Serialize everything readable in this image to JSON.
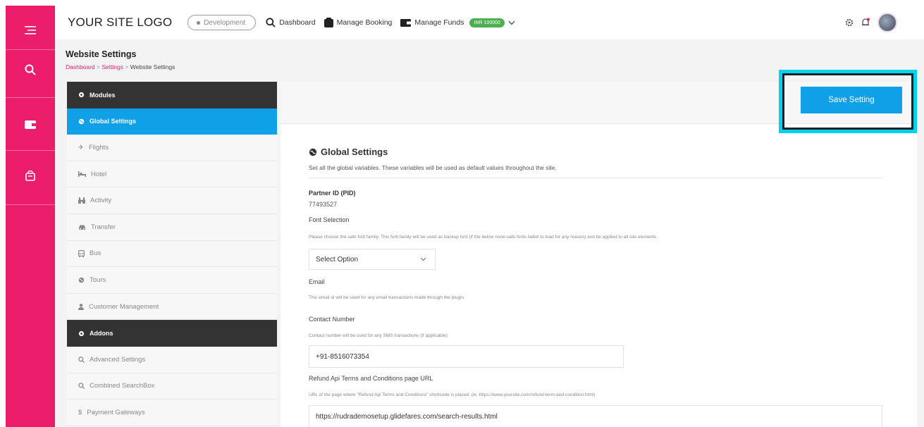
{
  "header": {
    "logo": "YOUR SITE LOGO",
    "environment": "Development",
    "nav": [
      {
        "label": "Dashboard",
        "icon": "search-icon"
      },
      {
        "label": "Manage Booking",
        "icon": "booking-icon"
      },
      {
        "label": "Manage Funds",
        "icon": "wallet-icon"
      }
    ],
    "funds_badge": "INR 100000"
  },
  "page": {
    "title": "Website Settings",
    "breadcrumb": {
      "item1": "Dashboard",
      "sep": ">",
      "item2": "Settings",
      "item3": "Website Settings"
    }
  },
  "sidebar": {
    "modules_header": "Modules",
    "active_item": "Global Settings",
    "modules": [
      {
        "label": "Flights",
        "icon": "plane-icon"
      },
      {
        "label": "Hotel",
        "icon": "bed-icon"
      },
      {
        "label": "Activity",
        "icon": "binoculars-icon"
      },
      {
        "label": "Transfer",
        "icon": "car-icon"
      },
      {
        "label": "Bus",
        "icon": "bus-icon"
      },
      {
        "label": "Tours",
        "icon": "globe-icon"
      },
      {
        "label": "Customer Management",
        "icon": "user-icon"
      }
    ],
    "addons_header": "Addons",
    "addons": [
      {
        "label": "Advanced Settings",
        "icon": "search-icon"
      },
      {
        "label": "Combined SearchBox",
        "icon": "search-icon"
      },
      {
        "label": "Payment Gateways",
        "icon": "dollar-icon"
      }
    ]
  },
  "main": {
    "save_label": "Save Setting",
    "section_title": "Global Settings",
    "section_desc": "Set all the global variables. These variables will be used as default values throughout the site.",
    "partner_label": "Partner ID (PID)",
    "partner_value": "77493527",
    "font_label": "Font Selection",
    "font_hint": "Please choose the safe font family. This font family will be used as backup font (if the below none-safe fonts failed to load for any reason) and be applied to all site elements.",
    "font_select": "Select Option",
    "email_label": "Email",
    "email_hint": "This email id will be used for any email transactions made through the plugin.",
    "contact_label": "Contact Number",
    "contact_hint": "Contact number will be used for any SMS transactions (if applicable)",
    "contact_value": "+91-8516073354",
    "refund_label": "Refund Api Terms and Conditions page URL",
    "refund_hint": "URL of the page where \"Refund Api Terms and Conditions\" shortcode is placed. (ie. https://www.yoursite.com/refund-term-and-condition.html)",
    "refund_value": "https://rudrademosetup.glidefares.com/search-results.html"
  },
  "colors": {
    "rail": "#ec1e6b",
    "accent": "#0fa0e8",
    "highlight": "#00d2f0",
    "badge": "#4caf50"
  }
}
